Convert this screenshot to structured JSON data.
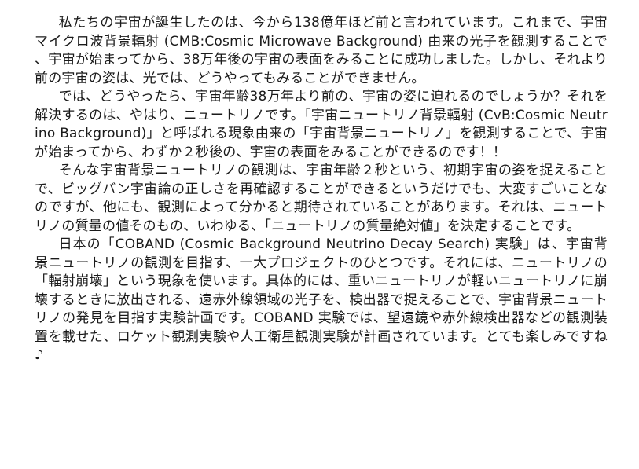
{
  "article": {
    "paragraphs": [
      "私たちの宇宙が誕生したのは、今から138億年ほど前と言われています。これまで、宇宙マイクロ波背景輻射 (CMB:Cosmic Microwave Background) 由来の光子を観測することで、宇宙が始まってから、38万年後の宇宙の表面をみることに成功しました。しかし、それより前の宇宙の姿は、光では、どうやってもみることができません。",
      "では、どうやったら、宇宙年齢38万年より前の、宇宙の姿に迫れるのでしょうか？それを解決するのは、やはり、ニュートリノです。「宇宙ニュートリノ背景輻射 (CvB:Cosmic Neutrino Background)」と呼ばれる現象由来の「宇宙背景ニュートリノ」を観測することで、宇宙が始まってから、わずか２秒後の、宇宙の表面をみることができるのです！！",
      "そんな宇宙背景ニュートリノの観測は、宇宙年齢２秒という、初期宇宙の姿を捉えることで、ビッグバン宇宙論の正しさを再確認することができるというだけでも、大変すごいことなのですが、他にも、観測によって分かると期待されていることがあります。それは、ニュートリノの質量の値そのもの、いわゆる、「ニュートリノの質量絶対値」を決定することです。",
      "日本の「COBAND (Cosmic Background Neutrino Decay Search) 実験」は、宇宙背景ニュートリノの観測を目指す、一大プロジェクトのひとつです。それには、ニュートリノの「輻射崩壊」という現象を使います。具体的には、重いニュートリノが軽いニュートリノに崩壊するときに放出される、遠赤外線領域の光子を、検出器で捉えることで、宇宙背景ニュートリノの発見を目指す実験計画です。COBAND 実験では、望遠鏡や赤外線検出器などの観測装置を載せた、ロケット観測実験や人工衛星観測実験が計画されています。とても楽しみですね♪"
    ]
  }
}
